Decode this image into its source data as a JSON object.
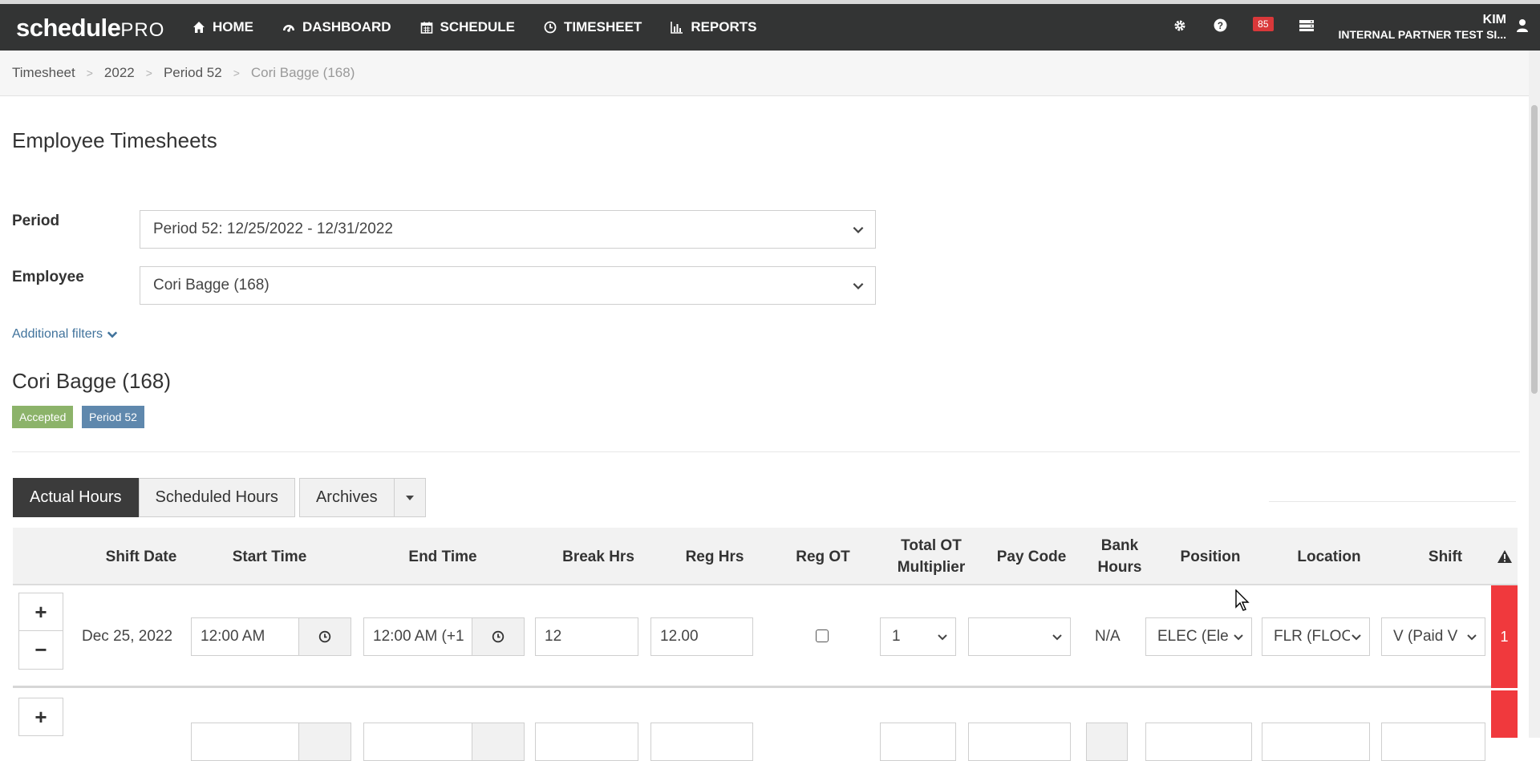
{
  "brand": {
    "main": "schedule",
    "suffix": "PRO"
  },
  "nav": {
    "items": [
      {
        "label": "HOME",
        "icon": "home-icon"
      },
      {
        "label": "DASHBOARD",
        "icon": "dashboard-icon"
      },
      {
        "label": "SCHEDULE",
        "icon": "calendar-icon"
      },
      {
        "label": "TIMESHEET",
        "icon": "clock-icon"
      },
      {
        "label": "REPORTS",
        "icon": "bar-chart-icon"
      }
    ],
    "notifications_count": "85",
    "user_name": "KIM",
    "org_name": "INTERNAL PARTNER TEST SI..."
  },
  "breadcrumb": [
    "Timesheet",
    "2022",
    "Period 52",
    "Cori Bagge (168)"
  ],
  "page": {
    "title": "Employee Timesheets"
  },
  "filters": {
    "period_label": "Period",
    "period_value": "Period 52: 12/25/2022 - 12/31/2022",
    "employee_label": "Employee",
    "employee_value": "Cori Bagge (168)",
    "additional_filters": "Additional filters"
  },
  "employee": {
    "name": "Cori Bagge (168)",
    "status_tag": "Accepted",
    "period_tag": "Period 52"
  },
  "tabs": [
    "Actual Hours",
    "Scheduled Hours",
    "Archives"
  ],
  "table": {
    "headers": {
      "shift_date": "Shift Date",
      "start_time": "Start Time",
      "end_time": "End Time",
      "break_hrs": "Break Hrs",
      "reg_hrs": "Reg Hrs",
      "reg_ot": "Reg OT",
      "total_ot_1": "Total OT",
      "total_ot_2": "Multiplier",
      "pay_code": "Pay Code",
      "bank_1": "Bank",
      "bank_2": "Hours",
      "position": "Position",
      "location": "Location",
      "shift": "Shift"
    },
    "rows": [
      {
        "shift_date": "Dec 25, 2022",
        "start_time": "12:00 AM",
        "end_time": "12:00 AM (+1",
        "break_hrs": "12",
        "reg_hrs": "12.00",
        "reg_ot_checked": false,
        "multiplier": "1",
        "pay_code": "",
        "bank_hours": "N/A",
        "position": "ELEC (Ele",
        "location": "FLR (FLOO",
        "shift": "V (Paid V",
        "warnings": "1"
      }
    ]
  },
  "colors": {
    "topbar": "#333434",
    "accepted": "#8cb36a",
    "period_tag": "#5f88ad",
    "warning": "#f0393d",
    "link": "#41739c"
  }
}
